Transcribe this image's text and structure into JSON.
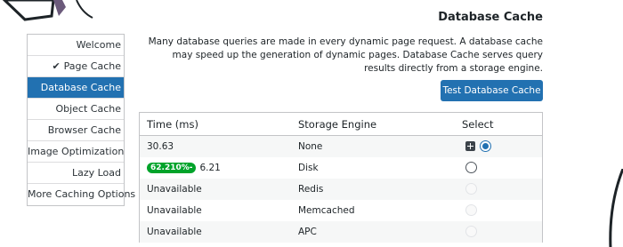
{
  "page": {
    "title": "Database Cache"
  },
  "sidebar": {
    "items": [
      {
        "label": "Welcome",
        "active": false,
        "checked": false
      },
      {
        "label": "Page Cache",
        "active": false,
        "checked": true
      },
      {
        "label": "Database Cache",
        "active": true,
        "checked": false
      },
      {
        "label": "Object Cache",
        "active": false,
        "checked": false
      },
      {
        "label": "Browser Cache",
        "active": false,
        "checked": false
      },
      {
        "label": "Image Optimization",
        "active": false,
        "checked": false
      },
      {
        "label": "Lazy Load",
        "active": false,
        "checked": false
      },
      {
        "label": "More Caching Options",
        "active": false,
        "checked": false
      }
    ]
  },
  "description": "Many database queries are made in every dynamic page request. A database cache may speed up the generation of dynamic pages. Database Cache serves query results directly from a storage engine.",
  "test_button": {
    "label": "Test Database Cache"
  },
  "table": {
    "headers": {
      "time": "Time (ms)",
      "engine": "Storage Engine",
      "select": "Select"
    },
    "rows": [
      {
        "time": "30.63",
        "badge": "",
        "engine": "None",
        "radio": "checked"
      },
      {
        "time": "6.21",
        "badge": "62.210%-",
        "engine": "Disk",
        "radio": "enabled"
      },
      {
        "time": "Unavailable",
        "badge": "",
        "engine": "Redis",
        "radio": "disabled"
      },
      {
        "time": "Unavailable",
        "badge": "",
        "engine": "Memcached",
        "radio": "disabled"
      },
      {
        "time": "Unavailable",
        "badge": "",
        "engine": "APC",
        "radio": "disabled"
      }
    ]
  },
  "colors": {
    "accent": "#2271b1",
    "badge": "#00a32a"
  },
  "icons": {
    "selected_row": "plus-square-icon",
    "check": "check-icon"
  }
}
